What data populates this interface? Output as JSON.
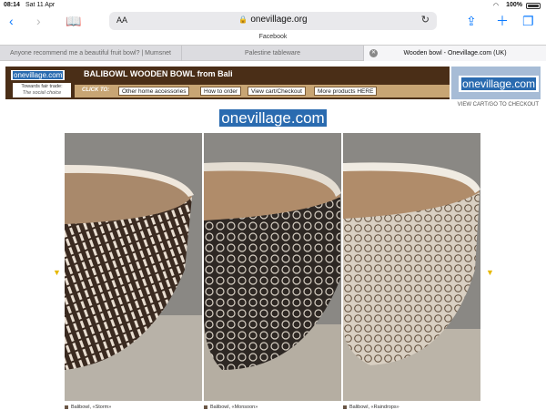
{
  "status": {
    "time": "08:14",
    "date": "Sat 11 Apr",
    "battery": "100%"
  },
  "toolbar": {
    "aa": "AA",
    "url": "onevillage.org"
  },
  "bookmark": "Facebook",
  "tabs": [
    {
      "label": "Anyone recommend me a beautiful fruit bowl? | Mumsnet"
    },
    {
      "label": "Palestine tableware"
    },
    {
      "label": "Wooden bowl - Onevillage.com (UK)"
    }
  ],
  "banner": {
    "logo": "onevillage.com",
    "title": "BALIBOWL WOODEN BOWL from Bali",
    "fair_line1": "Towards fair trade:",
    "fair_line2": "The social choice",
    "click_to": "CLICK TO:",
    "buttons": [
      "Other home accessories",
      "How to order",
      "View cart/Checkout",
      "More products HERE"
    ],
    "side_logo": "onevillage.com",
    "view_cart": "VIEW CART/GO TO CHECKOUT"
  },
  "main_logo": "onevillage.com",
  "gallery": [
    {
      "caption": "Balibowl, «Storm»"
    },
    {
      "caption": "Balibowl, «Monsoon»"
    },
    {
      "caption": "Balibowl, «Raindrops»"
    }
  ],
  "colors": {
    "accent": "#0a7aff",
    "brand_blue": "#2a6bb0",
    "banner_brown": "#4a2e17",
    "banner_tan": "#c8a574",
    "arrow": "#e6b800"
  }
}
